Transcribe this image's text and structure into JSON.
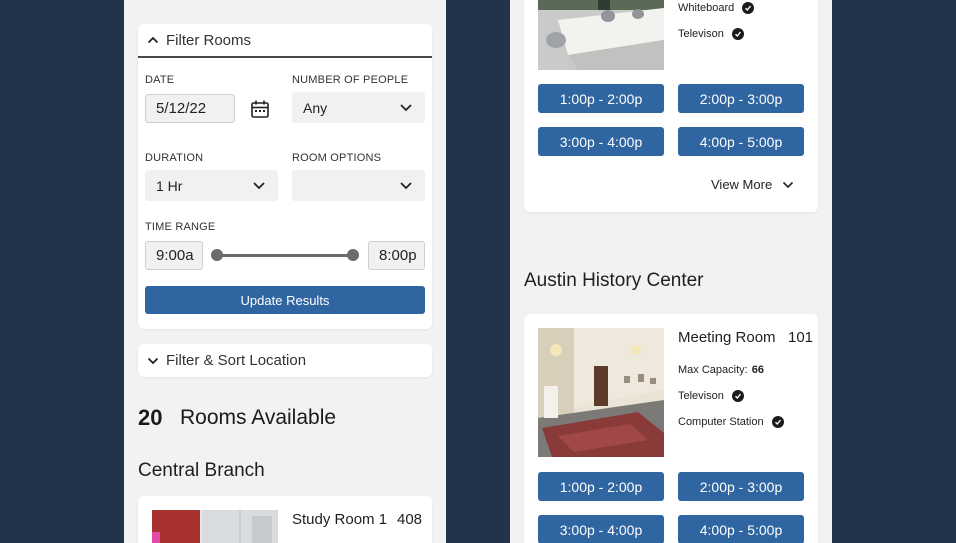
{
  "filter": {
    "title": "Filter Rooms",
    "date_label": "DATE",
    "date_value": "5/12/22",
    "people_label": "NUMBER OF PEOPLE",
    "people_value": "Any",
    "duration_label": "DURATION",
    "duration_value": "1 Hr",
    "options_label": "ROOM OPTIONS",
    "options_value": "",
    "time_range_label": "TIME RANGE",
    "time_start": "9:00a",
    "time_end": "8:00p",
    "update_button": "Update Results"
  },
  "sort": {
    "title": "Filter & Sort Location"
  },
  "results": {
    "count": "20",
    "label": "Rooms Available"
  },
  "central": {
    "name": "Central Branch",
    "room": {
      "title": "Study Room 1",
      "number": "408"
    }
  },
  "top_card": {
    "amenities": [
      "Whiteboard",
      "Televison"
    ],
    "slots": [
      "1:00p - 2:00p",
      "2:00p - 3:00p",
      "3:00p - 4:00p",
      "4:00p - 5:00p"
    ],
    "view_more": "View More"
  },
  "austin": {
    "name": "Austin History Center",
    "room": {
      "title": "Meeting Room",
      "number": "101",
      "capacity_label": "Max Capacity:",
      "capacity_value": "66",
      "amenities": [
        "Televison",
        "Computer Station"
      ],
      "slots": [
        "1:00p - 2:00p",
        "2:00p - 3:00p",
        "3:00p - 4:00p",
        "4:00p - 5:00p"
      ]
    }
  },
  "colors": {
    "primary": "#2f65a0",
    "background": "#22334a",
    "panel": "#f2f2f2"
  }
}
